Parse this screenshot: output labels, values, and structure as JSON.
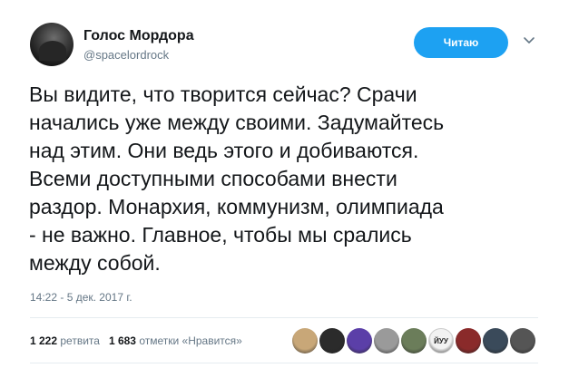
{
  "user": {
    "display_name": "Голос Мордора",
    "handle": "@spacelordrock"
  },
  "follow_button": {
    "label": "Читаю"
  },
  "tweet": {
    "lines": [
      "Вы видите, что творится сейчас? Срачи",
      "начались уже между своими. Задумайтесь",
      "над этим. Они ведь этого и добиваются.",
      "Всеми доступными способами внести",
      "раздор. Монархия, коммунизм, олимпиада",
      "- не важно. Главное, чтобы мы срались",
      "между собой."
    ],
    "timestamp": "14:22 - 5 дек. 2017 г."
  },
  "stats": {
    "retweets_count": "1 222",
    "retweets_label": "ретвита",
    "likes_count": "1 683",
    "likes_label": "отметки «Нравится»"
  },
  "liker_avatars": [
    {
      "name": "liker-avatar-1",
      "color": "#c8a778"
    },
    {
      "name": "liker-avatar-2",
      "color": "#2b2b2b"
    },
    {
      "name": "liker-avatar-3",
      "color": "#5b3fa8"
    },
    {
      "name": "liker-avatar-4",
      "color": "#9a9a9a"
    },
    {
      "name": "liker-avatar-5",
      "color": "#6b7d5a"
    },
    {
      "name": "liker-avatar-6",
      "color": "#f2f2f2"
    },
    {
      "name": "liker-avatar-7",
      "color": "#8a2a2a"
    },
    {
      "name": "liker-avatar-8",
      "color": "#3a4a5a"
    },
    {
      "name": "liker-avatar-9",
      "color": "#555555"
    }
  ],
  "liker_avatar_text": "ЙУУ",
  "colors": {
    "accent": "#1da1f2",
    "text": "#14171a",
    "secondary": "#657786",
    "divider": "#e6ecf0"
  }
}
